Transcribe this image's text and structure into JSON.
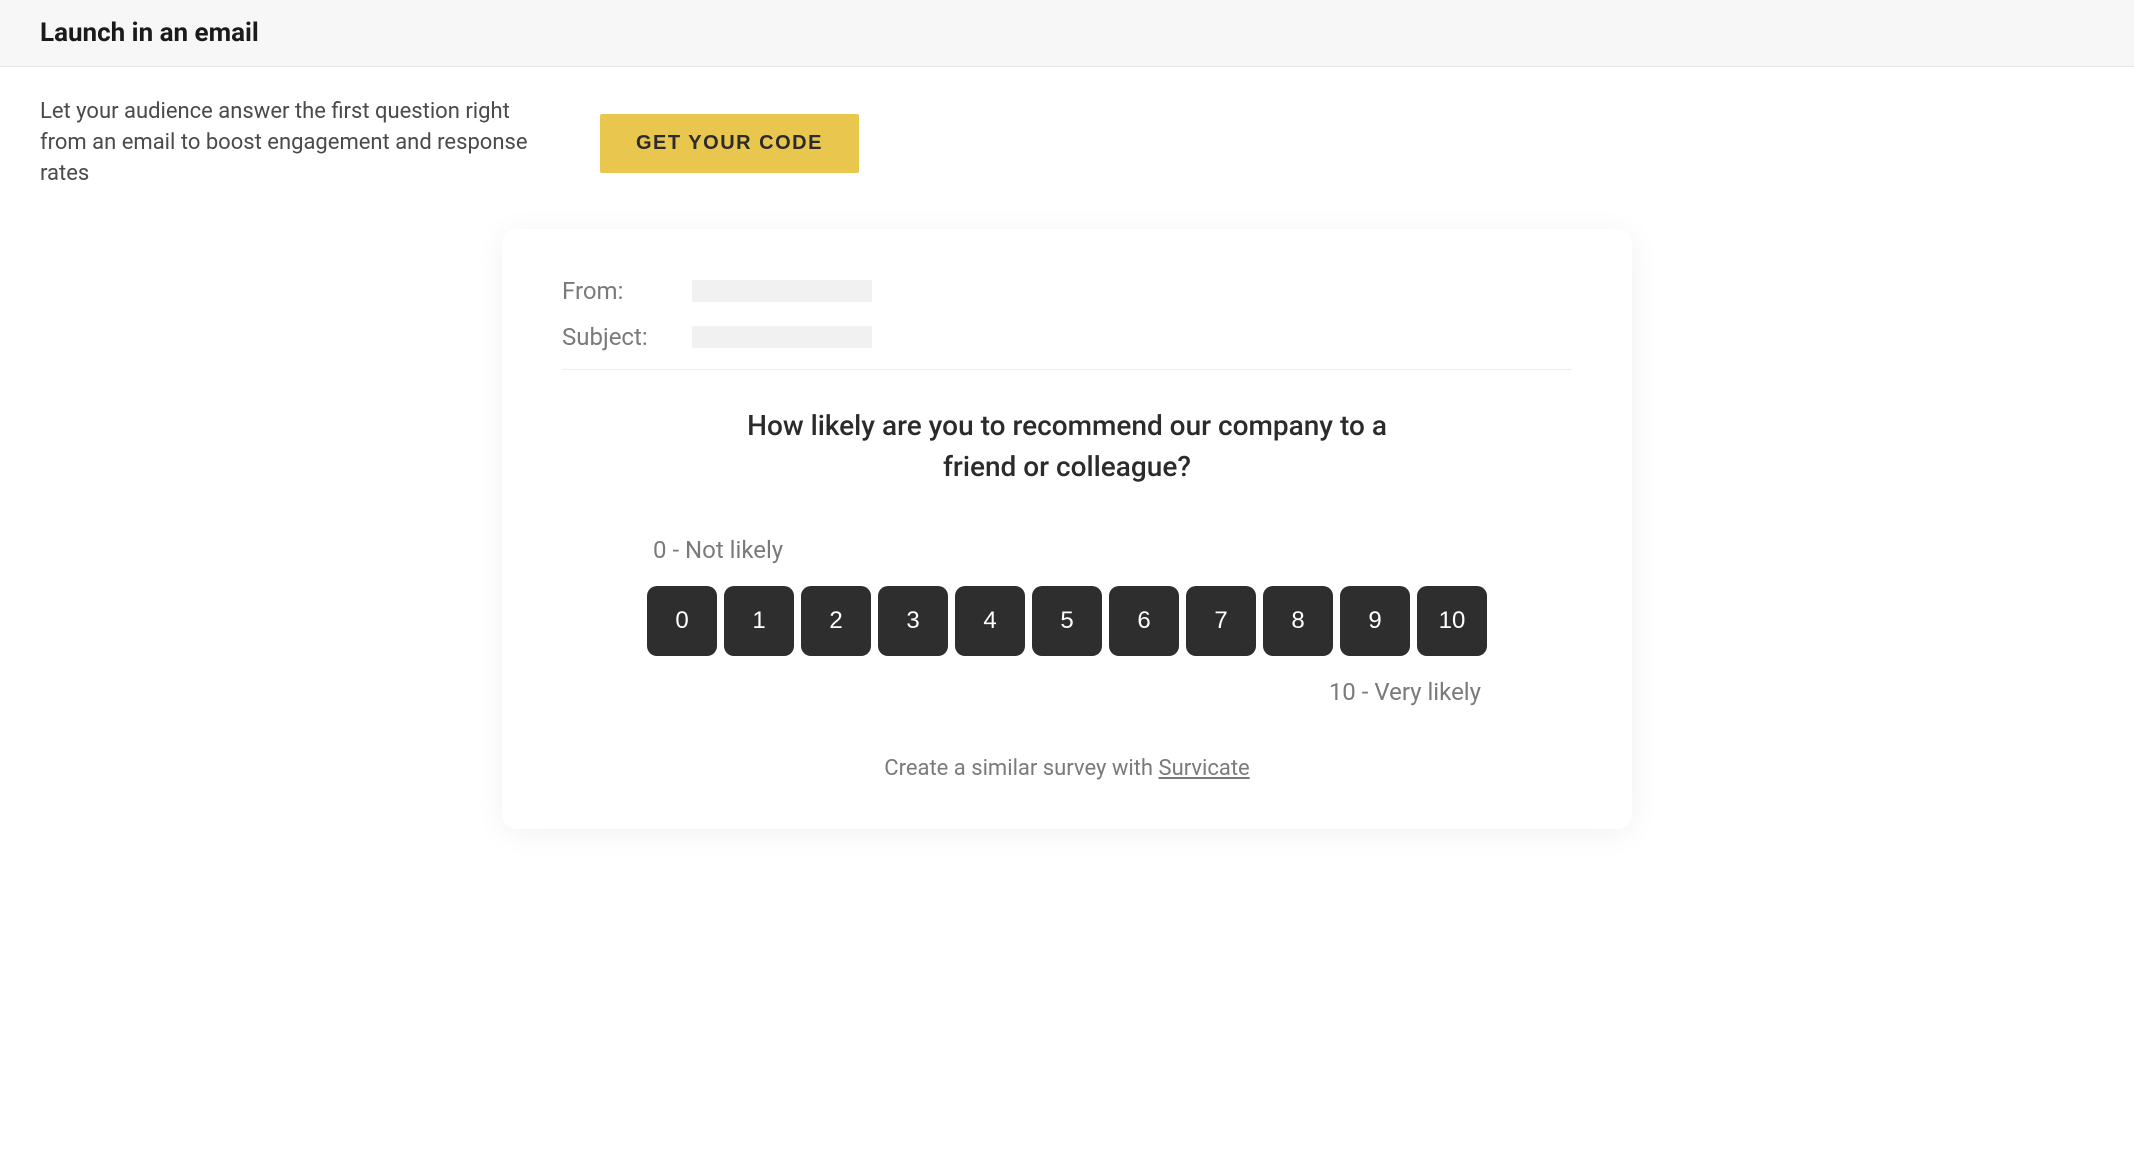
{
  "header": {
    "title": "Launch in an email"
  },
  "intro": {
    "text": "Let your audience answer the first question right from an email to boost engagement and response rates",
    "cta_label": "GET YOUR CODE"
  },
  "email_preview": {
    "from_label": "From:",
    "subject_label": "Subject:",
    "question": "How likely are you to recommend our company to a friend or colleague?",
    "scale_low_label": "0 - Not likely",
    "scale_high_label": "10 - Very likely",
    "scale_values": [
      "0",
      "1",
      "2",
      "3",
      "4",
      "5",
      "6",
      "7",
      "8",
      "9",
      "10"
    ],
    "footer_text": "Create a similar survey with ",
    "footer_link_text": "Survicate"
  },
  "colors": {
    "cta_bg": "#e9c74e",
    "scale_btn_bg": "#2e2e2e"
  }
}
